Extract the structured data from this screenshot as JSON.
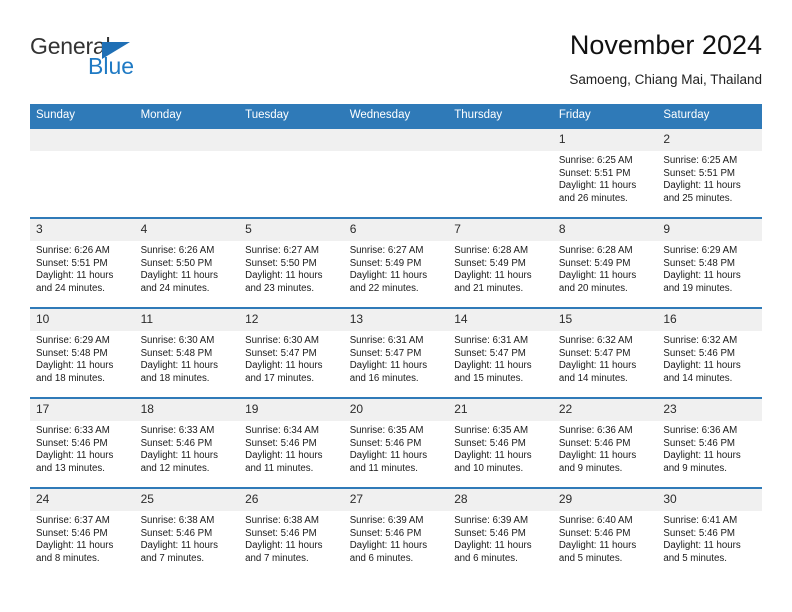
{
  "brand": {
    "name_part1": "General",
    "name_part2": "Blue",
    "accent_color": "#1f7ac4"
  },
  "header": {
    "title": "November 2024",
    "subtitle": "Samoeng, Chiang Mai, Thailand",
    "header_bg": "#2f7ab8"
  },
  "weekday_headers": [
    "Sunday",
    "Monday",
    "Tuesday",
    "Wednesday",
    "Thursday",
    "Friday",
    "Saturday"
  ],
  "weeks": [
    [
      {
        "day": "",
        "lines": []
      },
      {
        "day": "",
        "lines": []
      },
      {
        "day": "",
        "lines": []
      },
      {
        "day": "",
        "lines": []
      },
      {
        "day": "",
        "lines": []
      },
      {
        "day": "1",
        "lines": [
          "Sunrise: 6:25 AM",
          "Sunset: 5:51 PM",
          "Daylight: 11 hours",
          "and 26 minutes."
        ]
      },
      {
        "day": "2",
        "lines": [
          "Sunrise: 6:25 AM",
          "Sunset: 5:51 PM",
          "Daylight: 11 hours",
          "and 25 minutes."
        ]
      }
    ],
    [
      {
        "day": "3",
        "lines": [
          "Sunrise: 6:26 AM",
          "Sunset: 5:51 PM",
          "Daylight: 11 hours",
          "and 24 minutes."
        ]
      },
      {
        "day": "4",
        "lines": [
          "Sunrise: 6:26 AM",
          "Sunset: 5:50 PM",
          "Daylight: 11 hours",
          "and 24 minutes."
        ]
      },
      {
        "day": "5",
        "lines": [
          "Sunrise: 6:27 AM",
          "Sunset: 5:50 PM",
          "Daylight: 11 hours",
          "and 23 minutes."
        ]
      },
      {
        "day": "6",
        "lines": [
          "Sunrise: 6:27 AM",
          "Sunset: 5:49 PM",
          "Daylight: 11 hours",
          "and 22 minutes."
        ]
      },
      {
        "day": "7",
        "lines": [
          "Sunrise: 6:28 AM",
          "Sunset: 5:49 PM",
          "Daylight: 11 hours",
          "and 21 minutes."
        ]
      },
      {
        "day": "8",
        "lines": [
          "Sunrise: 6:28 AM",
          "Sunset: 5:49 PM",
          "Daylight: 11 hours",
          "and 20 minutes."
        ]
      },
      {
        "day": "9",
        "lines": [
          "Sunrise: 6:29 AM",
          "Sunset: 5:48 PM",
          "Daylight: 11 hours",
          "and 19 minutes."
        ]
      }
    ],
    [
      {
        "day": "10",
        "lines": [
          "Sunrise: 6:29 AM",
          "Sunset: 5:48 PM",
          "Daylight: 11 hours",
          "and 18 minutes."
        ]
      },
      {
        "day": "11",
        "lines": [
          "Sunrise: 6:30 AM",
          "Sunset: 5:48 PM",
          "Daylight: 11 hours",
          "and 18 minutes."
        ]
      },
      {
        "day": "12",
        "lines": [
          "Sunrise: 6:30 AM",
          "Sunset: 5:47 PM",
          "Daylight: 11 hours",
          "and 17 minutes."
        ]
      },
      {
        "day": "13",
        "lines": [
          "Sunrise: 6:31 AM",
          "Sunset: 5:47 PM",
          "Daylight: 11 hours",
          "and 16 minutes."
        ]
      },
      {
        "day": "14",
        "lines": [
          "Sunrise: 6:31 AM",
          "Sunset: 5:47 PM",
          "Daylight: 11 hours",
          "and 15 minutes."
        ]
      },
      {
        "day": "15",
        "lines": [
          "Sunrise: 6:32 AM",
          "Sunset: 5:47 PM",
          "Daylight: 11 hours",
          "and 14 minutes."
        ]
      },
      {
        "day": "16",
        "lines": [
          "Sunrise: 6:32 AM",
          "Sunset: 5:46 PM",
          "Daylight: 11 hours",
          "and 14 minutes."
        ]
      }
    ],
    [
      {
        "day": "17",
        "lines": [
          "Sunrise: 6:33 AM",
          "Sunset: 5:46 PM",
          "Daylight: 11 hours",
          "and 13 minutes."
        ]
      },
      {
        "day": "18",
        "lines": [
          "Sunrise: 6:33 AM",
          "Sunset: 5:46 PM",
          "Daylight: 11 hours",
          "and 12 minutes."
        ]
      },
      {
        "day": "19",
        "lines": [
          "Sunrise: 6:34 AM",
          "Sunset: 5:46 PM",
          "Daylight: 11 hours",
          "and 11 minutes."
        ]
      },
      {
        "day": "20",
        "lines": [
          "Sunrise: 6:35 AM",
          "Sunset: 5:46 PM",
          "Daylight: 11 hours",
          "and 11 minutes."
        ]
      },
      {
        "day": "21",
        "lines": [
          "Sunrise: 6:35 AM",
          "Sunset: 5:46 PM",
          "Daylight: 11 hours",
          "and 10 minutes."
        ]
      },
      {
        "day": "22",
        "lines": [
          "Sunrise: 6:36 AM",
          "Sunset: 5:46 PM",
          "Daylight: 11 hours",
          "and 9 minutes."
        ]
      },
      {
        "day": "23",
        "lines": [
          "Sunrise: 6:36 AM",
          "Sunset: 5:46 PM",
          "Daylight: 11 hours",
          "and 9 minutes."
        ]
      }
    ],
    [
      {
        "day": "24",
        "lines": [
          "Sunrise: 6:37 AM",
          "Sunset: 5:46 PM",
          "Daylight: 11 hours",
          "and 8 minutes."
        ]
      },
      {
        "day": "25",
        "lines": [
          "Sunrise: 6:38 AM",
          "Sunset: 5:46 PM",
          "Daylight: 11 hours",
          "and 7 minutes."
        ]
      },
      {
        "day": "26",
        "lines": [
          "Sunrise: 6:38 AM",
          "Sunset: 5:46 PM",
          "Daylight: 11 hours",
          "and 7 minutes."
        ]
      },
      {
        "day": "27",
        "lines": [
          "Sunrise: 6:39 AM",
          "Sunset: 5:46 PM",
          "Daylight: 11 hours",
          "and 6 minutes."
        ]
      },
      {
        "day": "28",
        "lines": [
          "Sunrise: 6:39 AM",
          "Sunset: 5:46 PM",
          "Daylight: 11 hours",
          "and 6 minutes."
        ]
      },
      {
        "day": "29",
        "lines": [
          "Sunrise: 6:40 AM",
          "Sunset: 5:46 PM",
          "Daylight: 11 hours",
          "and 5 minutes."
        ]
      },
      {
        "day": "30",
        "lines": [
          "Sunrise: 6:41 AM",
          "Sunset: 5:46 PM",
          "Daylight: 11 hours",
          "and 5 minutes."
        ]
      }
    ]
  ]
}
